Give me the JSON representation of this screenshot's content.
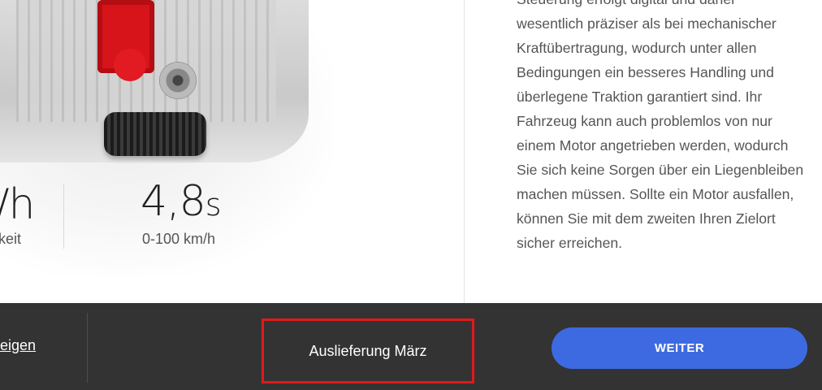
{
  "stats": [
    {
      "value": "/h",
      "unit": "",
      "label": "keit"
    },
    {
      "value": "4,8",
      "unit": "s",
      "label": "0-100 km/h"
    }
  ],
  "description_lines": [
    "Steuerung erfolgt digital und daher",
    "wesentlich präziser als bei mechanischer",
    "Kraftübertragung, wodurch unter allen",
    "Bedingungen ein besseres Handling und",
    "überlegene Traktion garantiert sind. Ihr",
    "Fahrzeug kann auch problemlos von nur",
    "einem Motor angetrieben werden, wodurch",
    "Sie sich keine Sorgen über ein Liegenbleiben",
    "machen müssen. Sollte ein Motor ausfallen,",
    "können Sie mit dem zweiten Ihren Zielort",
    "sicher erreichen."
  ],
  "bottom_bar": {
    "link_label": "eigen",
    "delivery_label": "Auslieferung März",
    "next_label": "WEITER"
  },
  "colors": {
    "bar_background": "#333333",
    "button_blue": "#3e6ae1",
    "highlight_red": "#e0191c",
    "motor_red": "#d8141b"
  }
}
